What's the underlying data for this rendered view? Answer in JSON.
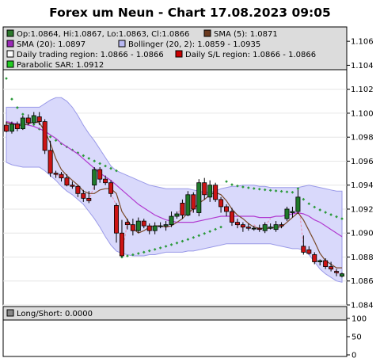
{
  "chart_data": {
    "type": "candlestick",
    "title": "Forex um Neun - Chart 17.08.2023 09:05",
    "legend": [
      {
        "label": "Op:1.0864, Hi:1.0867, Lo:1.0863, Cl:1.0866",
        "color": "#2d7a2d"
      },
      {
        "label": "SMA (5): 1.0871",
        "color": "#6b3a1f"
      },
      {
        "label": "SMA (20): 1.0897",
        "color": "#9b2ab8"
      },
      {
        "label": "Bollinger (20, 2): 1.0859 - 1.0935",
        "color": "#b7b7f2"
      },
      {
        "label": "Daily trading region: 1.0866 - 1.0866",
        "color": "#ffffff"
      },
      {
        "label": "Daily S/L region: 1.0866 - 1.0866",
        "color": "#cc0000"
      },
      {
        "label": "Parabolic SAR: 1.0912",
        "color": "#22cc22"
      }
    ],
    "y_ticks": [
      "1.106",
      "1.104",
      "1.102",
      "1.100",
      "1.098",
      "1.096",
      "1.094",
      "1.092",
      "1.090",
      "1.088",
      "1.086",
      "1.084"
    ],
    "ylim": [
      1.084,
      1.1072
    ],
    "candles": [
      [
        1.099,
        1.0993,
        1.0984,
        1.0985
      ],
      [
        1.0985,
        1.0993,
        1.0983,
        1.0991
      ],
      [
        1.0991,
        1.0993,
        1.0985,
        1.0987
      ],
      [
        1.0987,
        1.0998,
        1.0986,
        1.0996
      ],
      [
        1.0996,
        1.0999,
        1.099,
        1.0992
      ],
      [
        1.0992,
        1.1001,
        1.0991,
        1.0998
      ],
      [
        1.0997,
        1.1001,
        1.099,
        1.0993
      ],
      [
        1.0993,
        1.0995,
        1.0966,
        1.0969
      ],
      [
        1.0969,
        1.0977,
        1.0947,
        1.095
      ],
      [
        1.095,
        1.0952,
        1.0946,
        1.0949
      ],
      [
        1.0949,
        1.0951,
        1.0943,
        1.0946
      ],
      [
        1.0946,
        1.0949,
        1.0939,
        1.094
      ],
      [
        1.094,
        1.0943,
        1.0937,
        1.0939
      ],
      [
        1.0939,
        1.094,
        1.093,
        1.0933
      ],
      [
        1.0933,
        1.0936,
        1.0926,
        1.0929
      ],
      [
        1.0929,
        1.0935,
        1.0925,
        1.0927
      ],
      [
        1.094,
        1.0955,
        1.0936,
        1.0953
      ],
      [
        1.0953,
        1.0955,
        1.0942,
        1.0945
      ],
      [
        1.0945,
        1.0948,
        1.094,
        1.0942
      ],
      [
        1.0942,
        1.0944,
        1.093,
        1.0933
      ],
      [
        1.0923,
        1.0925,
        1.0892,
        1.09
      ],
      [
        1.09,
        1.0911,
        1.088,
        1.0881
      ],
      [
        1.0909,
        1.0912,
        1.0903,
        1.0907
      ],
      [
        1.0907,
        1.0912,
        1.0898,
        1.0902
      ],
      [
        1.0902,
        1.0913,
        1.09,
        1.091
      ],
      [
        1.091,
        1.0912,
        1.0904,
        1.0906
      ],
      [
        1.0906,
        1.0908,
        1.0899,
        1.0902
      ],
      [
        1.0902,
        1.0909,
        1.0899,
        1.0906
      ],
      [
        1.0906,
        1.0909,
        1.0904,
        1.0906
      ],
      [
        1.0906,
        1.091,
        1.0902,
        1.0907
      ],
      [
        1.0907,
        1.0918,
        1.0905,
        1.0914
      ],
      [
        1.0914,
        1.0918,
        1.0912,
        1.0916
      ],
      [
        1.0925,
        1.0928,
        1.0912,
        1.0915
      ],
      [
        1.0915,
        1.0935,
        1.0914,
        1.0932
      ],
      [
        1.0932,
        1.0934,
        1.0917,
        1.092
      ],
      [
        1.0917,
        1.0945,
        1.0914,
        1.0942
      ],
      [
        1.0942,
        1.0946,
        1.0928,
        1.0932
      ],
      [
        1.093,
        1.0944,
        1.0926,
        1.094
      ],
      [
        1.094,
        1.0942,
        1.0926,
        1.0928
      ],
      [
        1.0928,
        1.093,
        1.0917,
        1.0922
      ],
      [
        1.0922,
        1.0924,
        1.0914,
        1.0918
      ],
      [
        1.0918,
        1.0921,
        1.0906,
        1.0909
      ],
      [
        1.0909,
        1.0912,
        1.0904,
        1.0907
      ],
      [
        1.0907,
        1.0909,
        1.0901,
        1.0905
      ],
      [
        1.0905,
        1.0908,
        1.0902,
        1.0904
      ],
      [
        1.0904,
        1.0906,
        1.0902,
        1.0904
      ],
      [
        1.0904,
        1.0907,
        1.0901,
        1.0903
      ],
      [
        1.0902,
        1.0909,
        1.09,
        1.0907
      ],
      [
        1.0904,
        1.0908,
        1.0903,
        1.0905
      ],
      [
        1.0903,
        1.091,
        1.0901,
        1.0907
      ],
      [
        1.0907,
        1.0909,
        1.0904,
        1.0906
      ],
      [
        1.0912,
        1.0922,
        1.091,
        1.092
      ],
      [
        1.0917,
        1.0922,
        1.0913,
        1.0918
      ],
      [
        1.0918,
        1.0936,
        1.0916,
        1.093
      ],
      [
        1.0889,
        1.0898,
        1.0882,
        1.0884
      ],
      [
        1.0886,
        1.0889,
        1.0882,
        1.0883
      ],
      [
        1.0882,
        1.0884,
        1.0874,
        1.0876
      ],
      [
        1.0876,
        1.0878,
        1.0873,
        1.0877
      ],
      [
        1.0877,
        1.0879,
        1.087,
        1.0872
      ],
      [
        1.0872,
        1.0876,
        1.0868,
        1.087
      ],
      [
        1.0868,
        1.087,
        1.0864,
        1.0867
      ],
      [
        1.0864,
        1.0867,
        1.0863,
        1.0866
      ]
    ],
    "gap_lines": [
      [
        1.0949,
        1.0946
      ],
      [
        1.0927,
        1.094
      ],
      [
        1.0933,
        1.0923
      ],
      [
        1.0881,
        1.0909
      ],
      [
        1.0914,
        1.0925
      ],
      [
        1.092,
        1.0917
      ],
      [
        1.0935,
        1.093
      ],
      [
        1.0907,
        1.0904
      ],
      [
        1.0907,
        1.0903
      ],
      [
        1.0906,
        1.0912
      ],
      [
        1.092,
        1.0917
      ],
      [
        1.093,
        1.0889
      ],
      [
        1.0884,
        1.0886
      ],
      [
        1.087,
        1.0868
      ],
      [
        1.0867,
        1.0864
      ]
    ],
    "sma5": [
      1.0992,
      1.0991,
      1.099,
      1.099,
      1.0991,
      1.0993,
      1.0992,
      1.0985,
      1.0975,
      1.0962,
      1.0953,
      1.0948,
      1.0944,
      1.094,
      1.0935,
      1.0933,
      1.0933,
      1.0936,
      1.0937,
      1.0937,
      1.0933,
      1.0918,
      1.0911,
      1.0904,
      1.09,
      1.0902,
      1.0905,
      1.0906,
      1.0906,
      1.0905,
      1.0906,
      1.0909,
      1.0912,
      1.0917,
      1.092,
      1.0925,
      1.0928,
      1.0932,
      1.0934,
      1.0932,
      1.0927,
      1.092,
      1.0915,
      1.0912,
      1.0908,
      1.0905,
      1.0904,
      1.0904,
      1.0904,
      1.0905,
      1.0905,
      1.0909,
      1.0913,
      1.0917,
      1.0911,
      1.0902,
      1.0893,
      1.0883,
      1.0877,
      1.0874,
      1.0871,
      1.0871
    ],
    "sma20": [
      1.0993,
      1.0992,
      1.0991,
      1.0991,
      1.099,
      1.0989,
      1.0987,
      1.0985,
      1.0982,
      1.0979,
      1.0975,
      1.0972,
      1.0969,
      1.0966,
      1.0962,
      1.0958,
      1.0954,
      1.095,
      1.0947,
      1.0944,
      1.094,
      1.0936,
      1.0932,
      1.0928,
      1.0924,
      1.0921,
      1.0918,
      1.0915,
      1.0913,
      1.0911,
      1.091,
      1.0909,
      1.0909,
      1.0909,
      1.0909,
      1.091,
      1.0911,
      1.0912,
      1.0913,
      1.0914,
      1.0914,
      1.0914,
      1.0914,
      1.0914,
      1.0914,
      1.0914,
      1.0913,
      1.0913,
      1.0913,
      1.0914,
      1.0914,
      1.0915,
      1.0916,
      1.0917,
      1.0916,
      1.0914,
      1.0911,
      1.0909,
      1.0906,
      1.0903,
      1.09,
      1.0897
    ],
    "bb_upper": [
      1.1005,
      1.1005,
      1.1005,
      1.1005,
      1.1005,
      1.1005,
      1.1005,
      1.1008,
      1.1011,
      1.1013,
      1.1013,
      1.101,
      1.1005,
      1.0998,
      1.099,
      1.0983,
      1.0977,
      1.097,
      1.0963,
      1.0956,
      1.0952,
      1.095,
      1.0948,
      1.0946,
      1.0944,
      1.0942,
      1.094,
      1.0939,
      1.0938,
      1.0937,
      1.0937,
      1.0937,
      1.0937,
      1.0937,
      1.0936,
      1.0935,
      1.0934,
      1.0934,
      1.0935,
      1.0937,
      1.0938,
      1.0939,
      1.0939,
      1.094,
      1.094,
      1.094,
      1.0939,
      1.0939,
      1.0938,
      1.0938,
      1.0938,
      1.0938,
      1.0938,
      1.0938,
      1.0939,
      1.094,
      1.0939,
      1.0938,
      1.0937,
      1.0936,
      1.0935,
      1.0935
    ],
    "bb_lower": [
      1.0959,
      1.0957,
      1.0956,
      1.0955,
      1.0955,
      1.0955,
      1.0955,
      1.0952,
      1.0948,
      1.0944,
      1.0939,
      1.0935,
      1.0932,
      1.0928,
      1.0924,
      1.0918,
      1.0912,
      1.0905,
      1.0897,
      1.089,
      1.0885,
      1.0883,
      1.0882,
      1.0881,
      1.0881,
      1.0881,
      1.0882,
      1.0882,
      1.0883,
      1.0884,
      1.0884,
      1.0884,
      1.0884,
      1.0885,
      1.0885,
      1.0886,
      1.0887,
      1.0888,
      1.0889,
      1.089,
      1.0891,
      1.0891,
      1.0891,
      1.0891,
      1.0891,
      1.0891,
      1.0891,
      1.0891,
      1.0891,
      1.089,
      1.0889,
      1.0888,
      1.0887,
      1.0887,
      1.0886,
      1.0882,
      1.0876,
      1.087,
      1.0866,
      1.0863,
      1.086,
      1.0859
    ],
    "sar_segments": [
      {
        "from": 0,
        "start": 1.1029,
        "end": 1.0952
      },
      {
        "from": 21,
        "start": 1.088,
        "end": 1.0905
      },
      {
        "from": 40,
        "start": 1.0943,
        "end": 1.0934
      },
      {
        "from": 53,
        "start": 1.0937,
        "end": 1.0912
      }
    ],
    "sub_panel": {
      "label": "Long/Short: 0.0000",
      "y_ticks": [
        "100",
        "50",
        "0"
      ],
      "ylim": [
        0,
        100
      ]
    }
  }
}
